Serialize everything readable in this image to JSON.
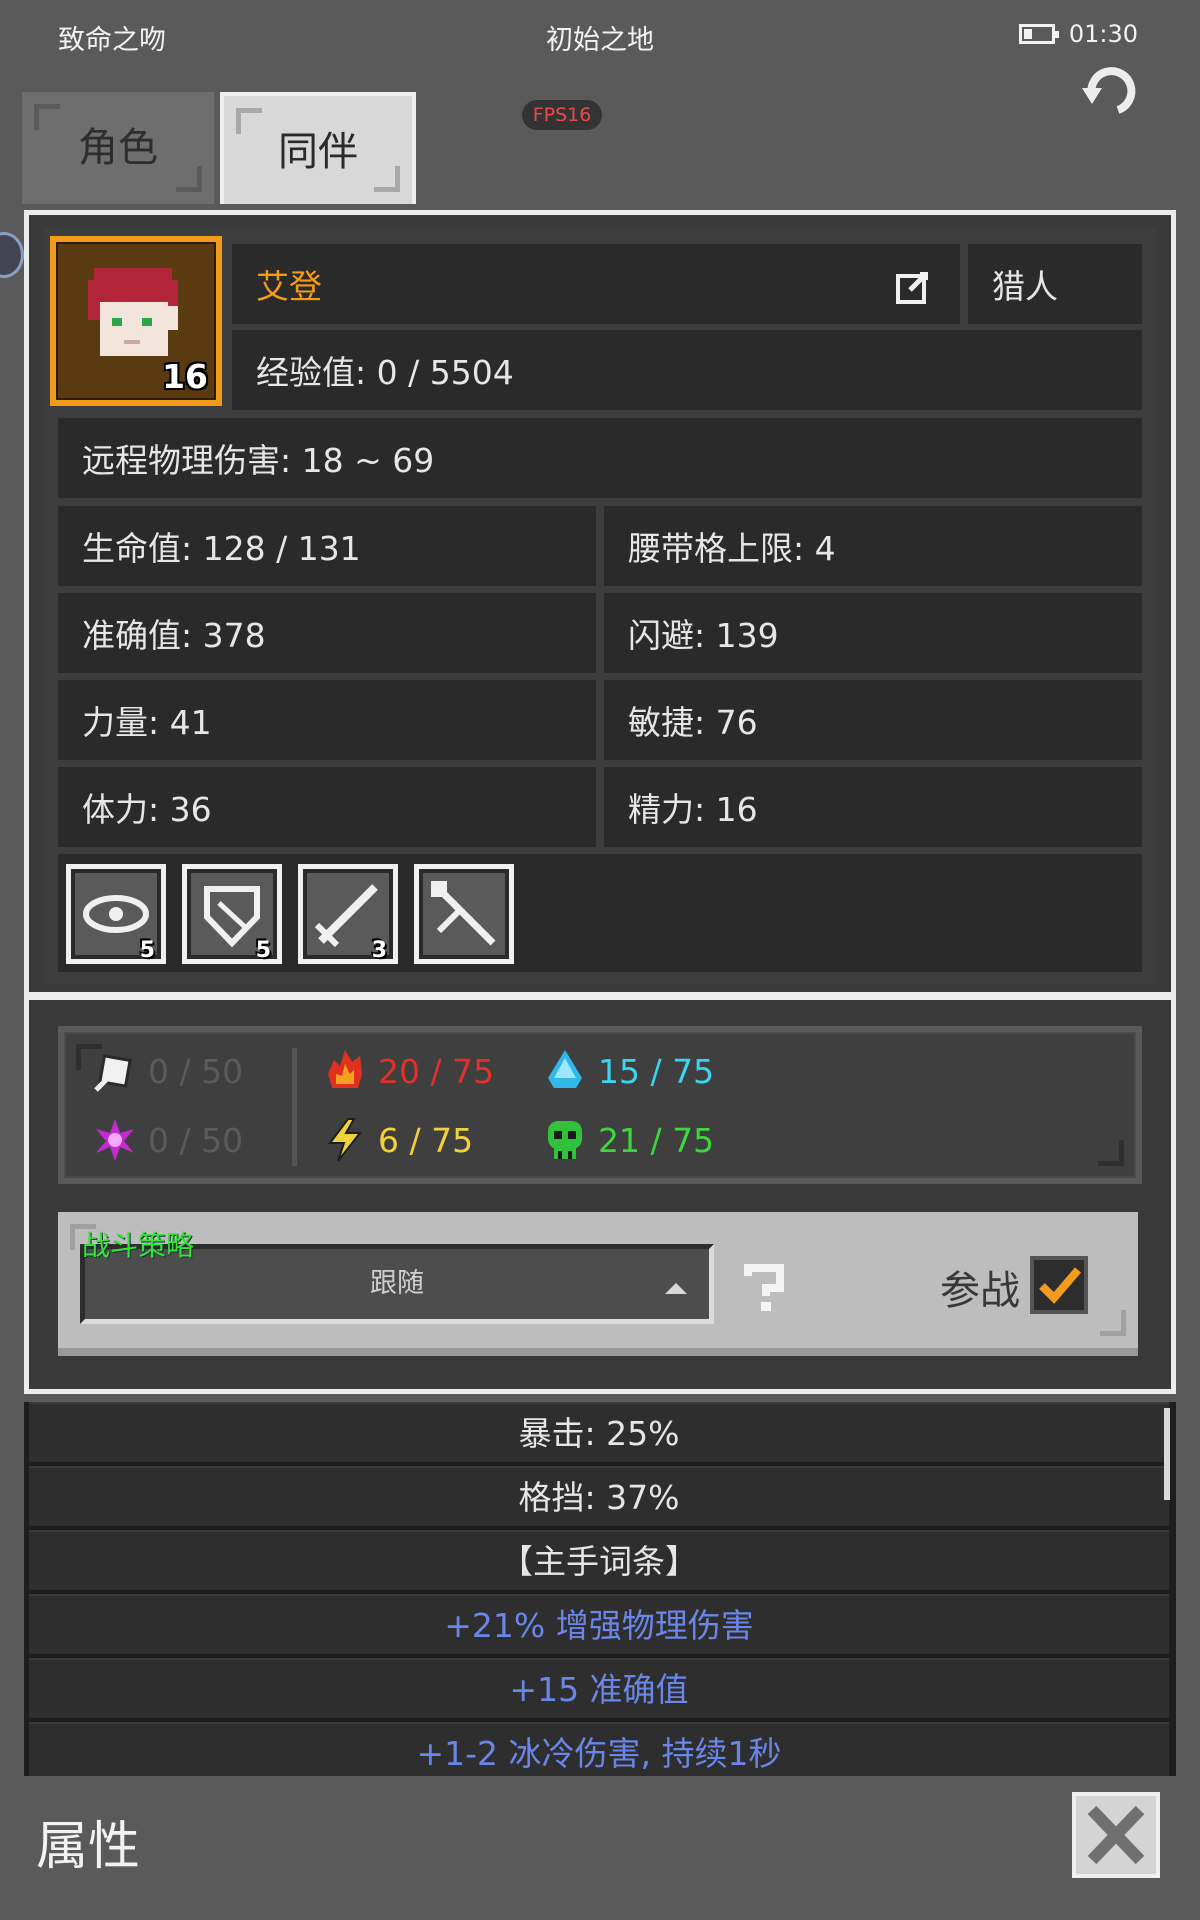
{
  "status_bar": {
    "left_title": "致命之吻",
    "location": "初始之地",
    "time": "01:30",
    "fps": "FPS16"
  },
  "tabs": [
    {
      "label": "角色",
      "active": false
    },
    {
      "label": "同伴",
      "active": true
    }
  ],
  "character": {
    "level": "16",
    "name": "艾登",
    "class": "猎人",
    "exp": "经验值: 0 / 5504",
    "ranged_damage": "远程物理伤害: 18 ~ 69",
    "stats_left": [
      "生命值: 128 / 131",
      "准确值: 378",
      "力量: 41",
      "体力: 36"
    ],
    "stats_right": [
      "腰带格上限: 4",
      "闪避: 139",
      "敏捷: 76",
      "精力: 16"
    ],
    "skills": [
      {
        "icon": "eye-skill-icon",
        "count": "5"
      },
      {
        "icon": "shield-skill-icon",
        "count": "5"
      },
      {
        "icon": "sword-skill-icon",
        "count": "3"
      },
      {
        "icon": "crossed-tools-skill-icon",
        "count": ""
      }
    ]
  },
  "resistances": {
    "physical": "0 / 50",
    "magic": "0 / 50",
    "fire": "20 / 75",
    "lightning": "6 / 75",
    "cold": "15 / 75",
    "poison": "21 / 75",
    "colors": {
      "dim": "#5b5b5b",
      "fire": "#e0312a",
      "lightning": "#f2d23a",
      "cold": "#3ad4f0",
      "poison": "#3ed63e"
    }
  },
  "strategy": {
    "label": "战斗策略",
    "selected": "跟随",
    "join_label": "参战",
    "join_checked": true
  },
  "details": [
    {
      "text": "暴击: 25%",
      "style": "white"
    },
    {
      "text": "格挡: 37%",
      "style": "white"
    },
    {
      "text": "【主手词条】",
      "style": "white"
    },
    {
      "text": "+21% 增强物理伤害",
      "style": "blue"
    },
    {
      "text": "+15 准确值",
      "style": "blue"
    },
    {
      "text": "+1-2 冰冷伤害, 持续1秒",
      "style": "blue"
    }
  ],
  "footer": {
    "title": "属性"
  }
}
